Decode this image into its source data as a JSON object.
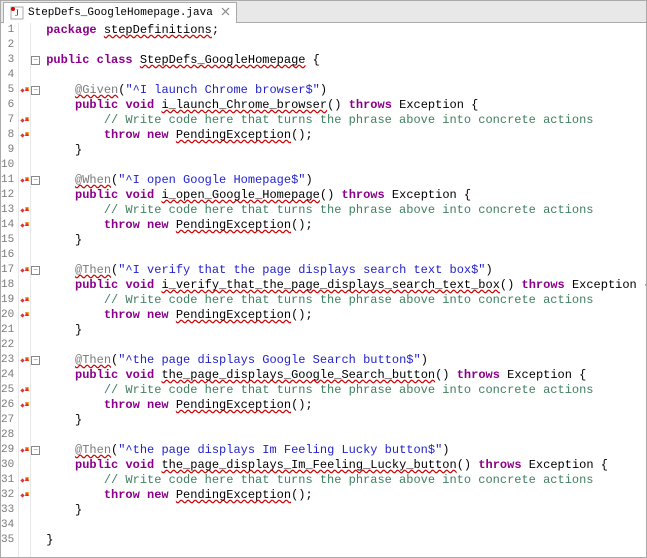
{
  "tab": {
    "filename": "StepDefs_GoogleHomepage.java",
    "close_icon": "x"
  },
  "code": {
    "l1": {
      "package": "package",
      "pkg": "stepDefinitions",
      "semi": ";"
    },
    "l3": {
      "public": "public",
      "class": "class",
      "name": "StepDefs_GoogleHomepage",
      "brace": " {"
    },
    "l5": {
      "ann": "@Given",
      "p1": "(",
      "str": "\"^I launch Chrome browser$\"",
      "p2": ")"
    },
    "l6": {
      "public": "public",
      "void": "void",
      "name": "i_launch_Chrome_browser",
      "p": "() ",
      "throws": "throws",
      "ex": " Exception {"
    },
    "l7": {
      "comment": "// Write code here that turns the phrase above into concrete actions"
    },
    "l8": {
      "throw": "throw",
      "new": "new",
      "ex": "PendingException",
      "end": "();"
    },
    "l9": {
      "brace": "}"
    },
    "l11": {
      "ann": "@When",
      "p1": "(",
      "str": "\"^I open Google Homepage$\"",
      "p2": ")"
    },
    "l12": {
      "public": "public",
      "void": "void",
      "name": "i_open_Google_Homepage",
      "p": "() ",
      "throws": "throws",
      "ex": " Exception {"
    },
    "l13": {
      "comment": "// Write code here that turns the phrase above into concrete actions"
    },
    "l14": {
      "throw": "throw",
      "new": "new",
      "ex": "PendingException",
      "end": "();"
    },
    "l15": {
      "brace": "}"
    },
    "l17": {
      "ann": "@Then",
      "p1": "(",
      "str": "\"^I verify that the page displays search text box$\"",
      "p2": ")"
    },
    "l18": {
      "public": "public",
      "void": "void",
      "name": "i_verify_that_the_page_displays_search_text_box",
      "p": "() ",
      "throws": "throws",
      "ex": " Exception {"
    },
    "l19": {
      "comment": "// Write code here that turns the phrase above into concrete actions"
    },
    "l20": {
      "throw": "throw",
      "new": "new",
      "ex": "PendingException",
      "end": "();"
    },
    "l21": {
      "brace": "}"
    },
    "l23": {
      "ann": "@Then",
      "p1": "(",
      "str": "\"^the page displays Google Search button$\"",
      "p2": ")"
    },
    "l24": {
      "public": "public",
      "void": "void",
      "name": "the_page_displays_Google_Search_button",
      "p": "() ",
      "throws": "throws",
      "ex": " Exception {"
    },
    "l25": {
      "comment": "// Write code here that turns the phrase above into concrete actions"
    },
    "l26": {
      "throw": "throw",
      "new": "new",
      "ex": "PendingException",
      "end": "();"
    },
    "l27": {
      "brace": "}"
    },
    "l29": {
      "ann": "@Then",
      "p1": "(",
      "str": "\"^the page displays Im Feeling Lucky button$\"",
      "p2": ")"
    },
    "l30": {
      "public": "public",
      "void": "void",
      "name": "the_page_displays_Im_Feeling_Lucky_button",
      "p": "() ",
      "throws": "throws",
      "ex": " Exception {"
    },
    "l31": {
      "comment": "// Write code here that turns the phrase above into concrete actions"
    },
    "l32": {
      "throw": "throw",
      "new": "new",
      "ex": "PendingException",
      "end": "();"
    },
    "l33": {
      "brace": "}"
    },
    "l35": {
      "brace": "}"
    }
  },
  "lines": [
    "1",
    "2",
    "3",
    "4",
    "5",
    "6",
    "7",
    "8",
    "9",
    "10",
    "11",
    "12",
    "13",
    "14",
    "15",
    "16",
    "17",
    "18",
    "19",
    "20",
    "21",
    "22",
    "23",
    "24",
    "25",
    "26",
    "27",
    "28",
    "29",
    "30",
    "31",
    "32",
    "33",
    "34",
    "35"
  ],
  "error_lines": [
    5,
    7,
    8,
    11,
    13,
    14,
    17,
    19,
    20,
    23,
    25,
    26,
    29,
    31,
    32
  ],
  "fold_lines": {
    "3": "-",
    "5": "-",
    "11": "-",
    "17": "-",
    "23": "-",
    "29": "-"
  }
}
